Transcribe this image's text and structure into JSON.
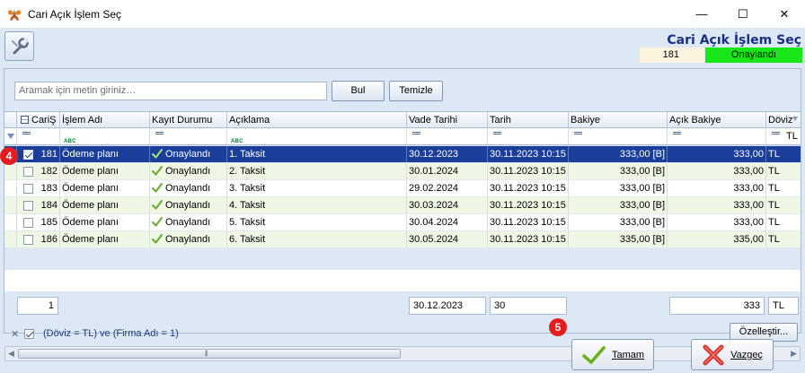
{
  "window": {
    "title": "Cari Açık İşlem Seç",
    "minimize_glyph": "—",
    "maximize_glyph": "☐",
    "close_glyph": "✕"
  },
  "header": {
    "title": "Cari Açık İşlem Seç",
    "id_value": "181",
    "status": "Onaylandı",
    "status_color": "#19e619"
  },
  "search": {
    "placeholder": "Aramak için metin giriniz…",
    "find_label": "Bul",
    "clear_label": "Temizle"
  },
  "columns": [
    "CariŞ",
    "İşlem Adı",
    "Kayıt Durumu",
    "Açıklama",
    "Vade Tarihi",
    "Tarih",
    "Bakiye",
    "Açık Bakiye",
    "Döviz"
  ],
  "filter_row": {
    "doviz_value": "TL"
  },
  "rows": [
    {
      "id": "181",
      "islem": "Ödeme planı",
      "durum": "Onaylandı",
      "aciklama": "1. Taksit",
      "vade": "30.12.2023",
      "tarih": "30.11.2023 10:15",
      "bakiye": "333,00 [B]",
      "acik": "333,00",
      "doviz": "TL",
      "checked": true,
      "selected": true
    },
    {
      "id": "182",
      "islem": "Ödeme planı",
      "durum": "Onaylandı",
      "aciklama": "2. Taksit",
      "vade": "30.01.2024",
      "tarih": "30.11.2023 10:15",
      "bakiye": "333,00 [B]",
      "acik": "333,00",
      "doviz": "TL",
      "checked": false,
      "selected": false
    },
    {
      "id": "183",
      "islem": "Ödeme planı",
      "durum": "Onaylandı",
      "aciklama": "3. Taksit",
      "vade": "29.02.2024",
      "tarih": "30.11.2023 10:15",
      "bakiye": "333,00 [B]",
      "acik": "333,00",
      "doviz": "TL",
      "checked": false,
      "selected": false
    },
    {
      "id": "184",
      "islem": "Ödeme planı",
      "durum": "Onaylandı",
      "aciklama": "4. Taksit",
      "vade": "30.03.2024",
      "tarih": "30.11.2023 10:15",
      "bakiye": "333,00 [B]",
      "acik": "333,00",
      "doviz": "TL",
      "checked": false,
      "selected": false
    },
    {
      "id": "185",
      "islem": "Ödeme planı",
      "durum": "Onaylandı",
      "aciklama": "5. Taksit",
      "vade": "30.04.2024",
      "tarih": "30.11.2023 10:15",
      "bakiye": "333,00 [B]",
      "acik": "333,00",
      "doviz": "TL",
      "checked": false,
      "selected": false
    },
    {
      "id": "186",
      "islem": "Ödeme planı",
      "durum": "Onaylandı",
      "aciklama": "6. Taksit",
      "vade": "30.05.2024",
      "tarih": "30.11.2023 10:15",
      "bakiye": "335,00 [B]",
      "acik": "335,00",
      "doviz": "TL",
      "checked": false,
      "selected": false
    }
  ],
  "summary": {
    "count": "1",
    "vade": "30.12.2023",
    "tarih": "30",
    "acik": "333",
    "doviz": "TL"
  },
  "filter_bar": {
    "clear_glyph": "✕",
    "text": "(Döviz = TL) ve (Firma Adı = 1)",
    "customize_label": "Özelleştir..."
  },
  "buttons": {
    "ok_label": "Tamam",
    "cancel_label": "Vazgeç"
  },
  "badges": {
    "row_marker": "4",
    "ok_marker": "5"
  }
}
